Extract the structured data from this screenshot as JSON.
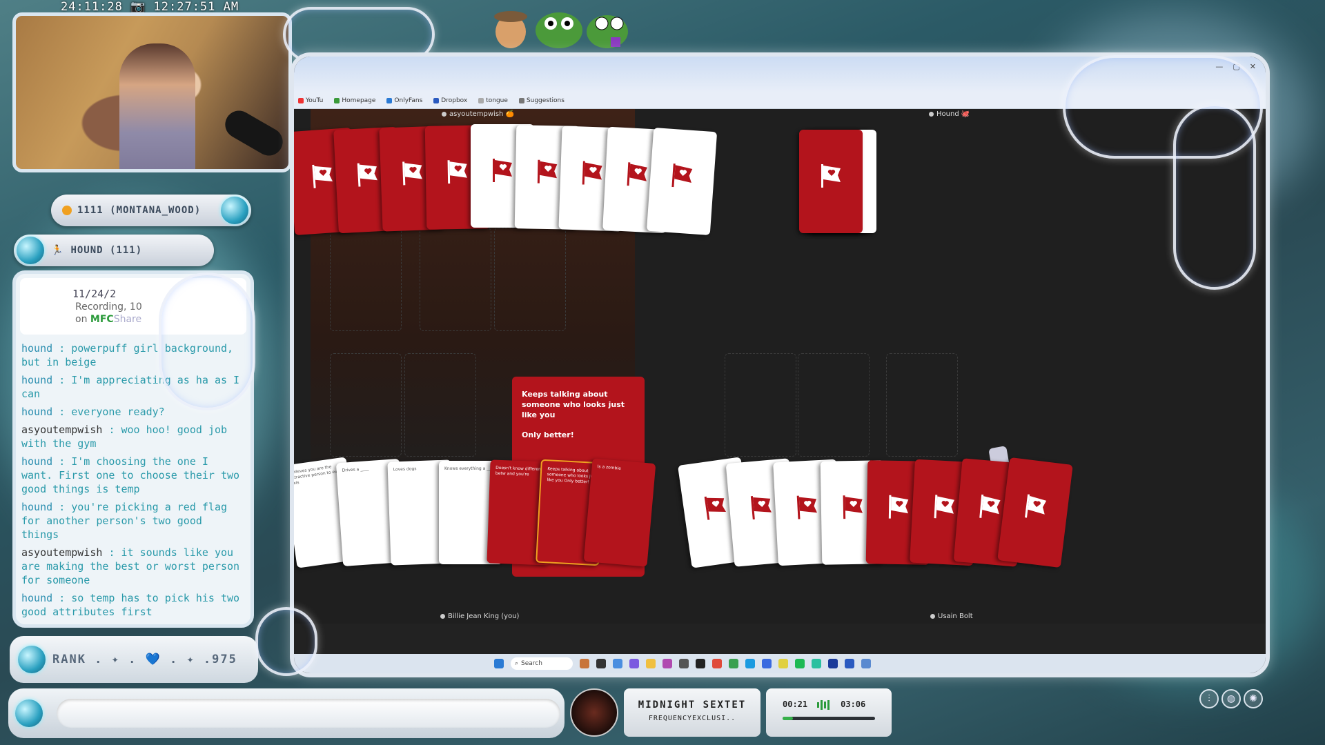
{
  "overlay": {
    "timestamp": "24:11:28 📷 12:27:51 AM",
    "viewer_pill": "1111 (MONTANA_WOOD)",
    "hound_pill": "HOUND (111)",
    "rank_text": "RANK . ✦ . 💙 . ✦ .975",
    "music": {
      "title": "MIDNIGHT SEXTET",
      "artist": "FREQUENCYEXCLUSI..",
      "elapsed": "00:21",
      "total": "03:06",
      "progress": 0.11
    },
    "colors": {
      "accent": "#2aa0c0",
      "card_red": "#b3141c"
    }
  },
  "chat": {
    "header": {
      "line1": "11/24/2",
      "line2": "Recording, 10",
      "line3": "on",
      "brand": "MFC",
      "brand2": "Share"
    },
    "messages": [
      {
        "user": "hound",
        "text": ": powerpuff girl background, but in beige"
      },
      {
        "user": "hound",
        "text": ": I'm appreciating as ha as I can"
      },
      {
        "user": "hound",
        "text": ": everyone ready?"
      },
      {
        "user": "asyoutempwish",
        "text": ": woo hoo! good job with the gym"
      },
      {
        "user": "hound",
        "text": ": I'm choosing the one I want. First one to choose their two good things is temp"
      },
      {
        "user": "hound",
        "text": ": you're picking a red flag for another person's two good things"
      },
      {
        "user": "asyoutempwish",
        "text": ": it sounds like you are making the best or worst person for someone"
      },
      {
        "user": "hound",
        "text": ": so temp has to pick his two good attributes first"
      }
    ]
  },
  "browser": {
    "bookmarks": [
      "YouTu",
      "Homepage",
      "OnlyFans",
      "Dropbox",
      "tongue",
      "Suggestions"
    ],
    "taskbar_search": "Search",
    "players": {
      "top_left": "asyoutempwish 🍊",
      "top_right": "Hound 🐙",
      "bottom_left": "Billie Jean King (you)",
      "bottom_right": "Usain Bolt"
    },
    "center_card": {
      "line1": "Keeps talking about someone who looks just like you",
      "line2": "Only better!"
    },
    "hand_cards": [
      "Believes you are the attractive person to ever exis",
      "Drives a ____",
      "Loves dogs",
      "Knows everything a ____",
      "Doesn't know difference betw and you're",
      "Keeps talking about someone who looks just like you Only better!",
      "Is a zombie"
    ]
  }
}
